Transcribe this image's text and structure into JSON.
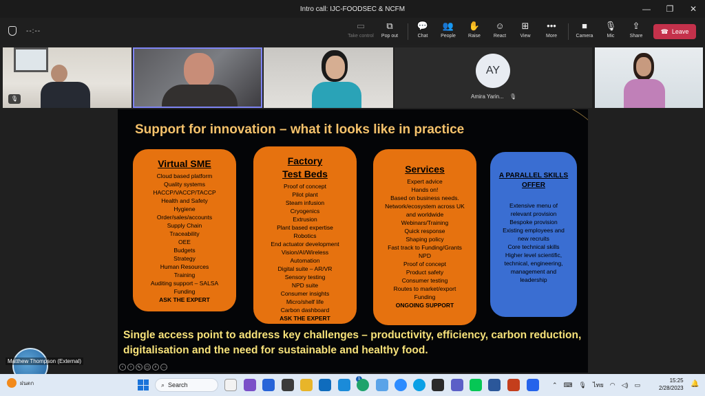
{
  "window": {
    "title": "Intro call: IJC-FOODSEC & NCFM",
    "minimize": "—",
    "maximize": "❐",
    "close": "✕"
  },
  "toolbar": {
    "timer": "--:--",
    "take_control": "Take control",
    "pop_out": "Pop out",
    "chat": "Chat",
    "people": "People",
    "raise": "Raise",
    "react": "React",
    "view": "View",
    "more": "More",
    "camera": "Camera",
    "mic": "Mic",
    "share": "Share",
    "leave": "Leave"
  },
  "participants": {
    "avatar_initials": "AY",
    "avatar_name": "Amira Yarin..."
  },
  "slide": {
    "title": "Support for innovation – what it looks like in practice",
    "col1": {
      "heading": "Virtual SME",
      "items": [
        "Cloud based platform",
        "Quality systems",
        "HACCP/VACCP/TACCP",
        "Health and Safety",
        "Hygiene",
        "Order/sales/accounts",
        "Supply Chain",
        "Traceability",
        "OEE",
        "Budgets",
        "Strategy",
        "Human Resources",
        "Training",
        "Auditing support – SALSA",
        "Funding"
      ],
      "strong": "ASK THE EXPERT"
    },
    "col2": {
      "heading1": "Factory",
      "heading2": "Test Beds",
      "items": [
        "Proof of concept",
        "Pilot plant",
        "Steam infusion",
        "Cryogenics",
        "Extrusion",
        "Plant based expertise",
        "Robotics",
        "End actuator development",
        "Vision/AI/Wireless",
        "Automation",
        "Digital suite – AR/VR",
        "Sensory testing",
        "NPD suite",
        "Consumer insights",
        "Micro/shelf life",
        "Carbon dashboard"
      ],
      "strong": "ASK THE EXPERT"
    },
    "col3": {
      "heading": "Services",
      "items": [
        "Expert advice",
        "Hands on!",
        "Based on business needs.",
        "Network/ecosystem across UK",
        "and worldwide",
        "Webinars/Training",
        "Quick response",
        "Shaping policy",
        "Fast track to Funding/Grants",
        "NPD",
        "Proof of concept",
        "Product safety",
        "Consumer testing",
        "Routes to market/export",
        "Funding"
      ],
      "strong": "ONGOING SUPPORT"
    },
    "col4": {
      "heading": "A PARALLEL SKILLS OFFER",
      "items": [
        "Extensive menu of",
        "relevant provision",
        "Bespoke provision",
        "Existing employees and",
        "new recruits",
        "Core technical skills",
        "Higher level scientific,",
        "technical, engineering,",
        "management and",
        "leadership"
      ]
    },
    "footer": "Single access point to address key challenges – productivity, efficiency, carbon reduction, digitalisation and the need for sustainable and healthy food."
  },
  "presenter_label": "Matthew Thompson (External)",
  "taskbar": {
    "weather": "ฝนตก",
    "search": "Search",
    "badge": "1",
    "lang": "ไทย",
    "time": "15:25",
    "date": "2/28/2023"
  },
  "colors": {
    "accent_purple": "#7f85f5",
    "leave_red": "#c4314b",
    "slide_orange": "#e6720f",
    "slide_blue": "#3a6ed2",
    "slide_title": "#f5c26b",
    "slide_footer": "#f7e27a"
  }
}
